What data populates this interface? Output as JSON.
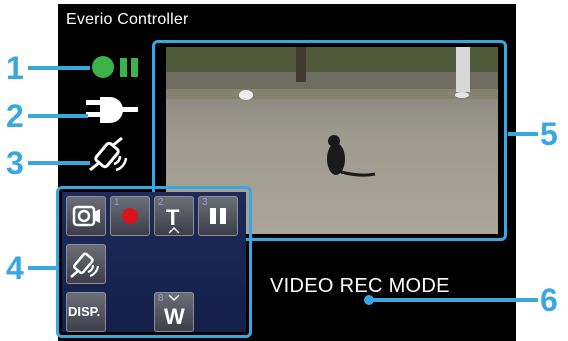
{
  "app": {
    "title": "Everio Controller"
  },
  "callouts": [
    "1",
    "2",
    "3",
    "4",
    "5",
    "6"
  ],
  "status": {
    "recording_icon": "green-dot-pause-icon",
    "power_icon": "ac-plug-icon",
    "signal_icon": "satellite-signal-icon"
  },
  "controls": {
    "mode_button": {
      "icon": "camera-mode-icon"
    },
    "record_button": {
      "number": "1",
      "icon": "record-dot-icon"
    },
    "tele_button": {
      "number": "2",
      "label": "T"
    },
    "pause_button": {
      "number": "3",
      "icon": "pause-icon"
    },
    "signal_button": {
      "icon": "satellite-signal-icon"
    },
    "disp_button": {
      "label": "DISP."
    },
    "wide_button": {
      "number": "8",
      "label": "W"
    }
  },
  "mode_text": "VIDEO REC MODE",
  "colors": {
    "accent": "#3aa8e0",
    "status_green": "#3ab44a",
    "panel_bg": "#1d2a5a",
    "record_red": "#d8141e"
  }
}
